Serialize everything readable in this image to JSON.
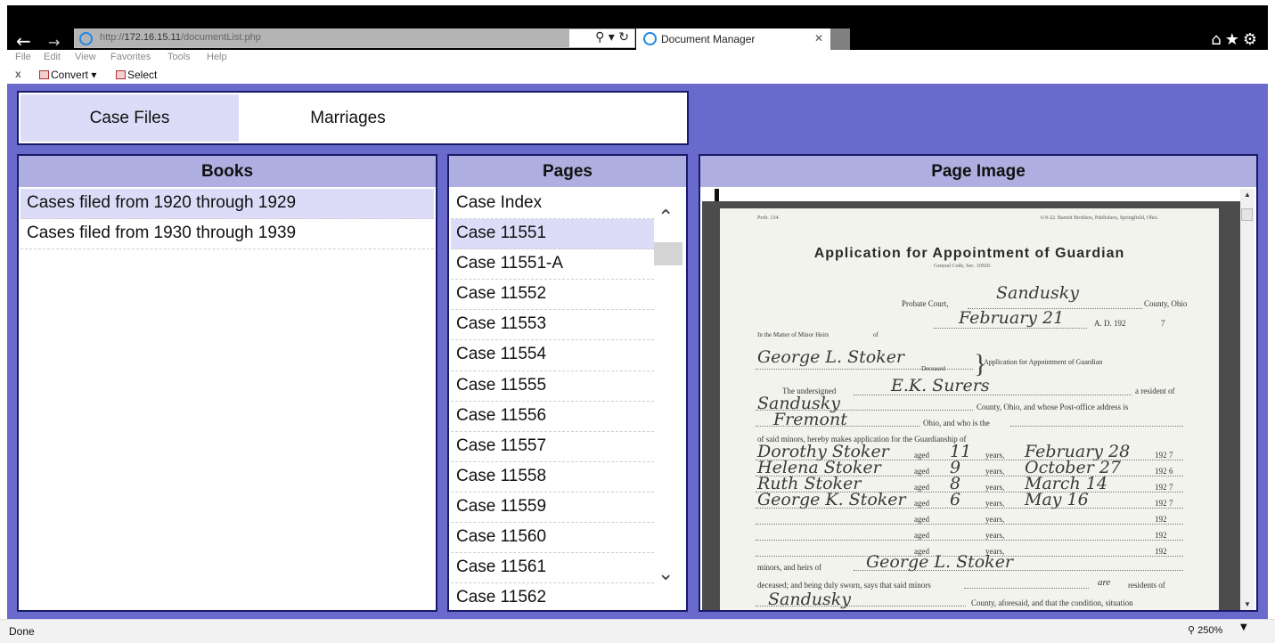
{
  "browser": {
    "url_prefix": "http://",
    "url_host": "172.16.15.11",
    "url_path": "/documentList.php",
    "tab_title": "Document Manager",
    "menu": [
      "File",
      "Edit",
      "View",
      "Favorites",
      "Tools",
      "Help"
    ],
    "commands": {
      "close": "x",
      "convert": "Convert",
      "convert_arrow": "▾",
      "select": "Select"
    },
    "status": "Done",
    "zoom": "250%"
  },
  "app": {
    "tabs": [
      {
        "label": "Case Files",
        "selected": true
      },
      {
        "label": "Marriages",
        "selected": false
      }
    ],
    "books": {
      "header": "Books",
      "items": [
        {
          "label": "Cases filed from 1920 through 1929",
          "selected": true
        },
        {
          "label": "Cases filed from 1930 through 1939",
          "selected": false
        }
      ]
    },
    "pages": {
      "header": "Pages",
      "items": [
        "Case Index",
        "Case 11551",
        "Case 11551-A",
        "Case 11552",
        "Case 11553",
        "Case 11554",
        "Case 11555",
        "Case 11556",
        "Case 11557",
        "Case 11558",
        "Case 11559",
        "Case 11560",
        "Case 11561",
        "Case 11562"
      ],
      "selected_index": 1
    },
    "image": {
      "header": "Page Image",
      "doc": {
        "form_no": "Prob. 134.",
        "publisher": "6-9-22. Barrett Brothers, Publishers, Springfield, Ohio.",
        "title": "Application for Appointment of Guardian",
        "subtitle": "General Code, Sec. 10920.",
        "court_label": "Probate Court,",
        "court_place": "Sandusky",
        "county_label": "County, Ohio",
        "date_hand": "February 21",
        "ad_label": "A. D. 192",
        "ad_year": "7",
        "matter_label": "In the Matter of Minor Heirs",
        "of_label": "of",
        "deceased_name": "George L. Stoker",
        "deceased_label": "Deceased",
        "app_label": "Application for Appointment of Guardian",
        "undersigned_label": "The undersigned",
        "applicant": "E.K. Surers",
        "resident_label": "a resident of",
        "county_hand": "Sandusky",
        "postoffice_label": "County, Ohio, and whose Post-office address is",
        "town_hand": "Fremont",
        "ohio_label": "Ohio, and who is the",
        "minors_label": "of said minors, hereby makes application for the Guardianship of",
        "aged_label": "aged",
        "years_label": "years,",
        "year_prefix": "192",
        "children": [
          {
            "name": "Dorothy Stoker",
            "age": "11",
            "month": "February 28",
            "year": "7"
          },
          {
            "name": "Helena Stoker",
            "age": "9",
            "month": "October 27",
            "year": "6"
          },
          {
            "name": "Ruth Stoker",
            "age": "8",
            "month": "March 14",
            "year": "7"
          },
          {
            "name": "George K. Stoker",
            "age": "6",
            "month": "May 16",
            "year": "7"
          }
        ],
        "heirs_label": "minors, and heirs of",
        "heirs_name": "George L. Stoker",
        "sworn_label": "deceased; and being duly sworn, says that said minors",
        "are_hand": "are",
        "residents_label": "residents of",
        "final_hand": "Sandusky",
        "final_label": "County, aforesaid, and that the condition, situation"
      }
    }
  }
}
